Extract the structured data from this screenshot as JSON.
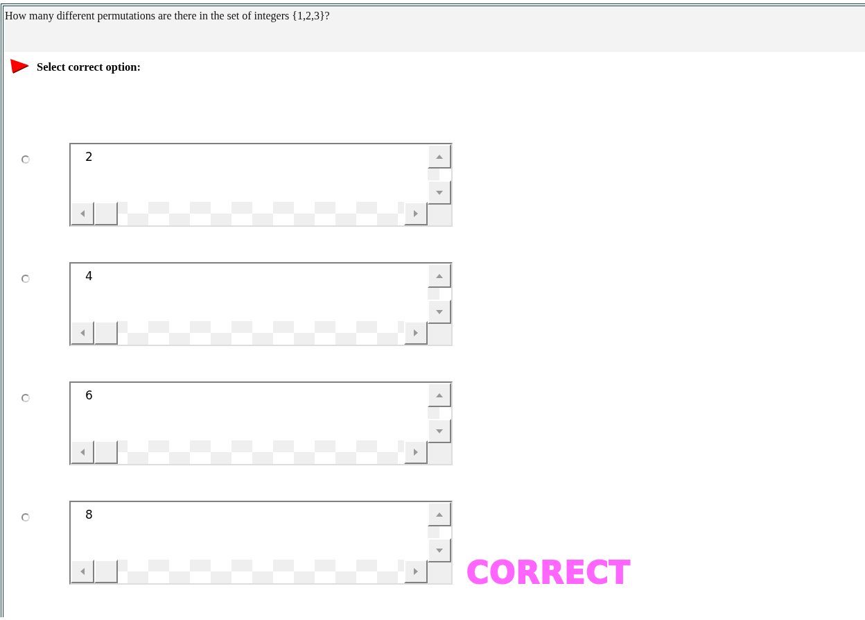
{
  "question": {
    "text": "How many different permutations are there in the set of integers {1,2,3}?"
  },
  "prompt": {
    "text": "Select correct option:"
  },
  "options": [
    {
      "value": "2",
      "selected": false
    },
    {
      "value": "4",
      "selected": false
    },
    {
      "value": "6",
      "selected": false
    },
    {
      "value": "8",
      "selected": false
    }
  ],
  "feedback": {
    "text": "CORRECT"
  }
}
